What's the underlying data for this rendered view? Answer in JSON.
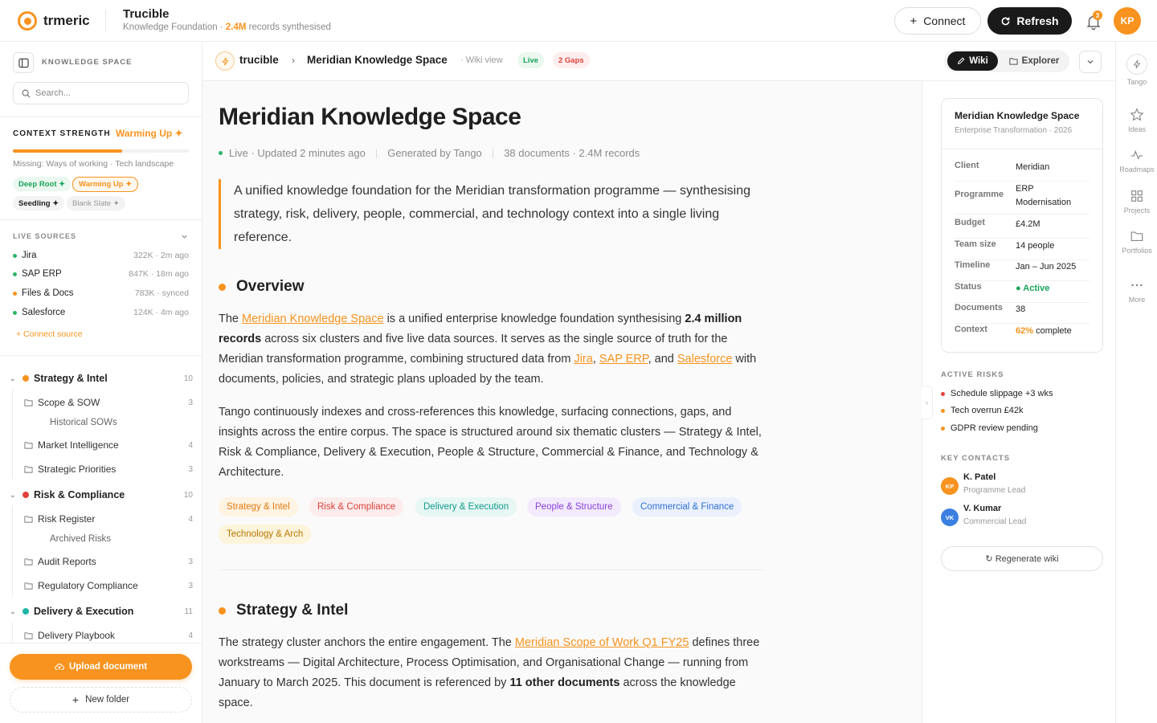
{
  "brand": {
    "logo_text": "trmeric",
    "accent": "#f7931e"
  },
  "header": {
    "app_title": "Trucible",
    "subtitle_prefix": "Knowledge Foundation · ",
    "subtitle_highlight": "2.4M",
    "subtitle_suffix": " records synthesised",
    "connect_label": "Connect",
    "refresh_label": "Refresh",
    "notification_count": "3",
    "user_initials": "KP"
  },
  "sidebar": {
    "title": "KNOWLEDGE SPACE",
    "search_placeholder": "Search...",
    "context": {
      "label": "CONTEXT STRENGTH",
      "state": "Warming Up ✦",
      "progress": 0.62,
      "missing": "Missing: Ways of working · Tech landscape",
      "chips": [
        "Deep Root ✦",
        "Warming Up ✦",
        "Seedling ✦",
        "Blank Slate ✦"
      ]
    },
    "live_sources_label": "LIVE SOURCES",
    "sources": [
      {
        "name": "Jira",
        "meta": "322K · 2m ago",
        "color": "#2db468"
      },
      {
        "name": "SAP ERP",
        "meta": "847K · 18m ago",
        "color": "#2db468"
      },
      {
        "name": "Files & Docs",
        "meta": "783K · synced",
        "color": "#f7931e"
      },
      {
        "name": "Salesforce",
        "meta": "124K · 4m ago",
        "color": "#2db468"
      }
    ],
    "connect_source": "+ Connect source",
    "tree": [
      {
        "name": "Strategy & Intel",
        "count": "10",
        "color": "#f7931e",
        "items": [
          {
            "name": "Scope & SOW",
            "count": "3",
            "sub": "Historical SOWs"
          },
          {
            "name": "Market Intelligence",
            "count": "4"
          },
          {
            "name": "Strategic Priorities",
            "count": "3"
          }
        ]
      },
      {
        "name": "Risk & Compliance",
        "count": "10",
        "color": "#e0413b",
        "items": [
          {
            "name": "Risk Register",
            "count": "4",
            "sub": "Archived Risks"
          },
          {
            "name": "Audit Reports",
            "count": "3"
          },
          {
            "name": "Regulatory Compliance",
            "count": "3"
          }
        ]
      },
      {
        "name": "Delivery & Execution",
        "count": "11",
        "color": "#1fb5a4",
        "items": [
          {
            "name": "Delivery Playbook",
            "count": "4"
          }
        ]
      }
    ],
    "upload_label": "Upload document",
    "new_folder_label": "New folder"
  },
  "content_header": {
    "brand": "trucible",
    "arrow": "›",
    "title": "Meridian Knowledge Space",
    "view": "· Wiki view",
    "live": "Live",
    "gaps": "2 Gaps",
    "wiki_tab": "Wiki",
    "explorer_tab": "Explorer"
  },
  "article": {
    "title": "Meridian Knowledge Space",
    "meta": [
      "Live · Updated 2 minutes ago",
      "Generated by Tango",
      "38 documents · 2.4M records"
    ],
    "quote": "A unified knowledge foundation for the Meridian transformation programme — synthesising strategy, risk, delivery, people, commercial, and technology context into a single living reference.",
    "overview_heading": "Overview",
    "overview_p1": {
      "t1": "The ",
      "l1": "Meridian Knowledge Space",
      "t2": " is a unified enterprise knowledge foundation synthesising ",
      "b1": "2.4 million records",
      "t3": " across six clusters and five live data sources. It serves as the single source of truth for the Meridian transformation programme, combining structured data from ",
      "l2": "Jira",
      "t4": ", ",
      "l3": "SAP ERP",
      "t5": ", and ",
      "l4": "Salesforce",
      "t6": " with documents, policies, and strategic plans uploaded by the team."
    },
    "overview_p2": "Tango continuously indexes and cross-references this knowledge, surfacing connections, gaps, and insights across the entire corpus. The space is structured around six thematic clusters — Strategy & Intel, Risk & Compliance, Delivery & Execution, People & Structure, Commercial & Finance, and Technology & Architecture.",
    "tags": [
      {
        "label": "Strategy & Intel",
        "fg": "#e07b10",
        "bg": "#fff3e2"
      },
      {
        "label": "Risk & Compliance",
        "fg": "#d9413b",
        "bg": "#fdecec"
      },
      {
        "label": "Delivery & Execution",
        "fg": "#14998a",
        "bg": "#e6f7f4"
      },
      {
        "label": "People & Structure",
        "fg": "#8a3fd9",
        "bg": "#f3ebfd"
      },
      {
        "label": "Commercial & Finance",
        "fg": "#2f6fd1",
        "bg": "#eaf1fd"
      },
      {
        "label": "Technology & Arch",
        "fg": "#b87700",
        "bg": "#fdf4dc"
      }
    ],
    "strategy_heading": "Strategy & Intel",
    "strategy_p": {
      "t1": "The strategy cluster anchors the entire engagement. The ",
      "l1": "Meridian Scope of Work Q1 FY25",
      "t2": " defines three workstreams — Digital Architecture, Process Optimisation, and Organisational Change — running from January to March 2025. This document is referenced by ",
      "b1": "11 other documents",
      "t3": " across the knowledge space."
    }
  },
  "panel": {
    "title": "Meridian Knowledge Space",
    "subtitle": "Enterprise Transformation · 2026",
    "rows": [
      {
        "k": "Client",
        "v": "Meridian"
      },
      {
        "k": "Programme",
        "v": "ERP Modernisation"
      },
      {
        "k": "Budget",
        "v": "£4.2M"
      },
      {
        "k": "Team size",
        "v": "14 people"
      },
      {
        "k": "Timeline",
        "v": "Jan – Jun 2025"
      },
      {
        "k": "Status",
        "v": "● Active"
      },
      {
        "k": "Documents",
        "v": "38"
      },
      {
        "k": "Context",
        "v_hl": "62%",
        "v": " complete"
      }
    ],
    "risks_label": "ACTIVE RISKS",
    "risks": [
      {
        "text": "Schedule slippage +3 wks",
        "color": "#e0413b"
      },
      {
        "text": "Tech overrun £42k",
        "color": "#f7931e"
      },
      {
        "text": "GDPR review pending",
        "color": "#f7931e"
      }
    ],
    "contacts_label": "KEY CONTACTS",
    "contacts": [
      {
        "initials": "KP",
        "name": "K. Patel",
        "role": "Programme Lead",
        "color": "#f7931e"
      },
      {
        "initials": "VK",
        "name": "V. Kumar",
        "role": "Commercial Lead",
        "color": "#3b7fe0"
      }
    ],
    "regenerate_label": "↻ Regenerate wiki"
  },
  "rail": [
    {
      "label": "Tango",
      "icon": "bolt-icon"
    },
    {
      "label": "Ideas",
      "icon": "star-icon"
    },
    {
      "label": "Roadmaps",
      "icon": "pulse-icon"
    },
    {
      "label": "Projects",
      "icon": "grid-icon"
    },
    {
      "label": "Portfolios",
      "icon": "folder-icon"
    },
    {
      "label": "More",
      "icon": "dots-icon"
    }
  ]
}
